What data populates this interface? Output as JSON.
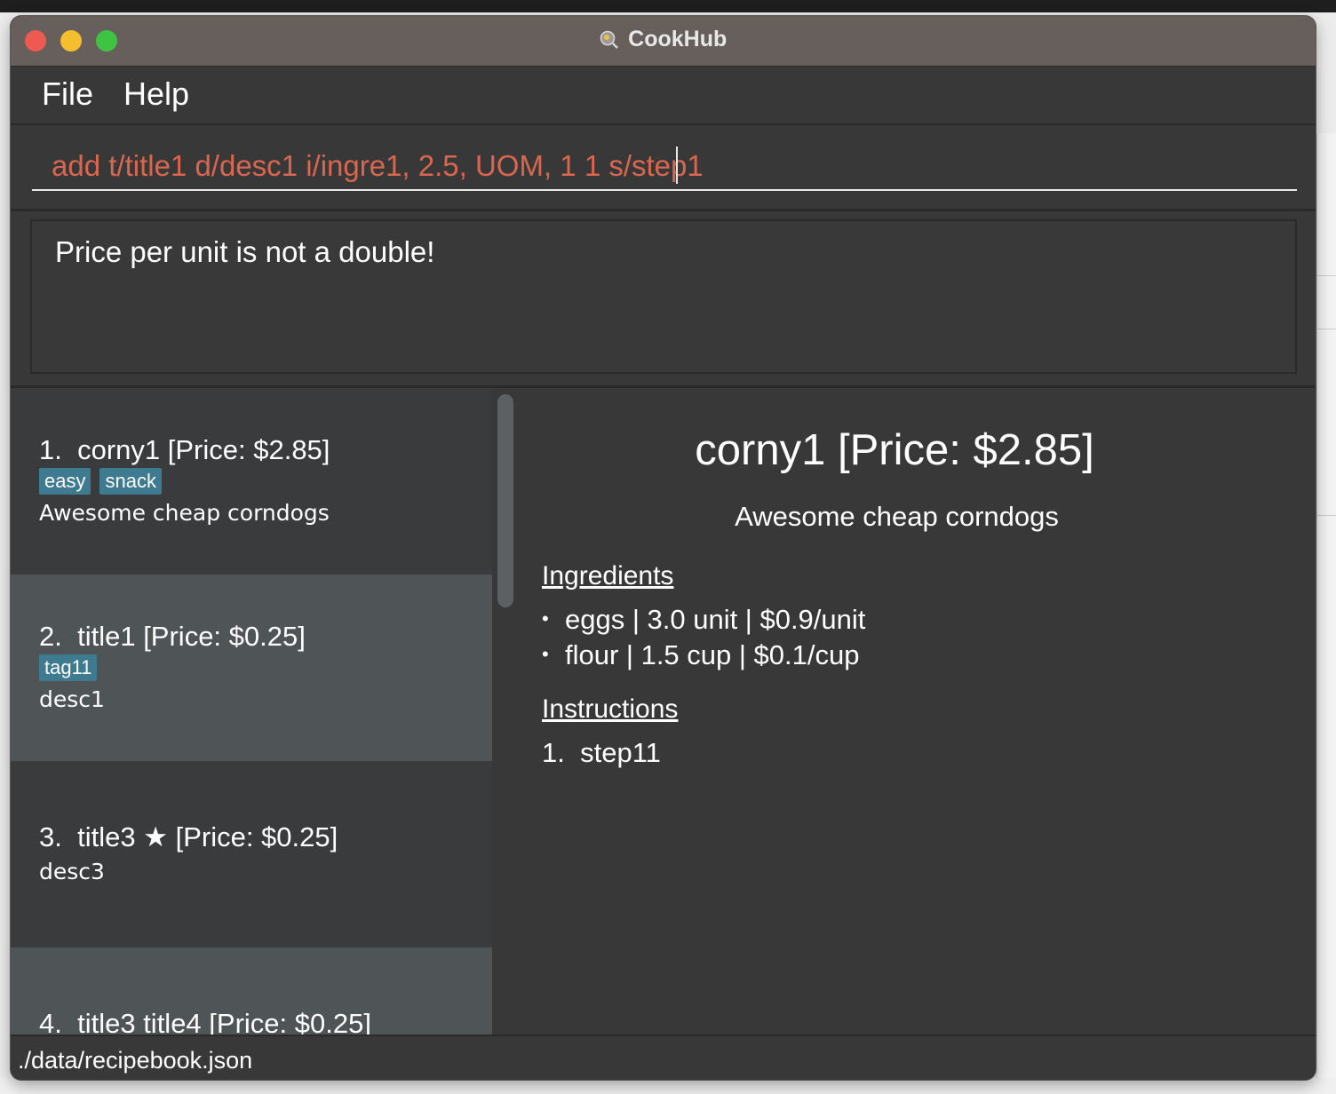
{
  "window": {
    "title": "CookHub",
    "app_icon": "cookhub-logo"
  },
  "menu": [
    {
      "label": "File"
    },
    {
      "label": "Help"
    }
  ],
  "command": {
    "value": "add t/title1 d/desc1 i/ingre1, 2.5, UOM, 1 1 s/step1"
  },
  "result": {
    "message": "Price per unit is not a double!"
  },
  "recipes": [
    {
      "number": "1.",
      "title": "corny1 [Price: $2.85]",
      "tags": [
        "easy",
        "snack"
      ],
      "description": "Awesome cheap corndogs"
    },
    {
      "number": "2.",
      "title": "title1 [Price: $0.25]",
      "tags": [
        "tag11"
      ],
      "description": "desc1"
    },
    {
      "number": "3.",
      "title": "title3 ★ [Price: $0.25]",
      "tags": [],
      "description": "desc3"
    },
    {
      "number": "4.",
      "title": "title3 title4 [Price: $0.25]",
      "tags": [],
      "description": ""
    }
  ],
  "detail": {
    "title": "corny1 [Price: $2.85]",
    "description": "Awesome cheap corndogs",
    "ingredients_heading": "Ingredients",
    "ingredients": [
      "eggs | 3.0 unit | $0.9/unit",
      "flour | 1.5 cup | $0.1/cup"
    ],
    "instructions_heading": "Instructions",
    "instructions": [
      {
        "number": "1.",
        "text": "step11"
      }
    ]
  },
  "status": {
    "path": "./data/recipebook.json"
  },
  "colors": {
    "tag": "#3e7b91",
    "command_text": "#d9674f",
    "selected_row": "#4f5457"
  }
}
